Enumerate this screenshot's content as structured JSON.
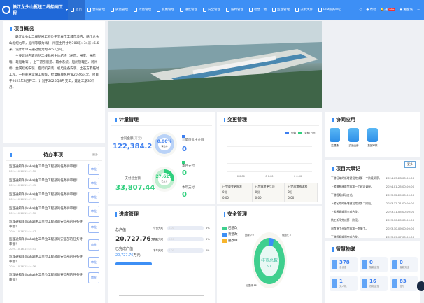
{
  "header": {
    "title": "赣江龙头山枢纽二线船闸工程",
    "nav": [
      "首页",
      "合同管理",
      "质量管理",
      "计量管理",
      "变更管理",
      "进度管理",
      "安全管理",
      "履约管理",
      "智慧工地",
      "监理管理",
      "决策大屏",
      "BIM服务中心"
    ],
    "help": "帮助",
    "notify": "通知",
    "notify_badge": "99+",
    "user": "湘金城"
  },
  "intro": {
    "title": "项目概况",
    "p1": "赣江龙头山二线船闸工程位于宜春市丰城市境内，赣江龙头山枢纽右岸，船闸等级为Ⅱ级，闸室主尺寸为300米×34米×5.6米，设计年单向通过能力为3763万吨。",
    "p2": "主要建设内容包括二线船闸主体结构（闸首、闸室、导航墙、靠船墩等），上下游引航道、输水系统、船闸管理区、跨闸桥、金属结构安装、启闭机安装、机电设备安装、土石方及临时工程、一线船闸实施工程等，批复概算总投资20.46亿元。项目于2023年8月开工，计划于2026年8月交工，建设工期36个月。"
  },
  "todo": {
    "title": "待办事项",
    "more": "更多",
    "action": "审批",
    "items": [
      {
        "text": "监理通知单(haha)由工单位工程部的任务待审批！",
        "time": "2024-10-16 15:17:50"
      },
      {
        "text": "监理通知单(haha)由工单位工程部的任务待审批！",
        "time": "2024-10-16 15:17:45"
      },
      {
        "text": "监理通知单(haha)由工单位工程部的任务待审批！",
        "time": "2024-10-16 15:17:39"
      },
      {
        "text": "监理通知单(haha)由工单位工程部的任务待审批！",
        "time": "2024-10-16 15:17:30"
      },
      {
        "text": "监理通知单(haha)由工单位工程部的安全部的任务待审批！",
        "time": "2024-10-16 15:14:47"
      },
      {
        "text": "监理通知单(haha)由工单位工程部的安全部的任务待审批！",
        "time": "2024-10-16 15:14:41"
      },
      {
        "text": "监理通知单(haha)由工单位工程部的安全部的任务待审批！",
        "time": "2024-10-16 15:14:36"
      },
      {
        "text": "监理通知单(haha)由工单位工程部的安全部的任务待审批！",
        "time": ""
      }
    ]
  },
  "measure": {
    "title": "计量管理",
    "contract_label": "合同金额",
    "unit": "(万元)",
    "contract": "122,384.27",
    "pct1": "0.00%",
    "pct1_label": "审批中",
    "paid_label": "支付总金额",
    "paid": "33,807.44",
    "pct2": "27.62%",
    "pct2_label": "已支付",
    "pct2_value": 27.62,
    "review_label": "计量审批中金额",
    "review": "0",
    "month_label": "本月支付",
    "month": "0",
    "year_label": "本年支付",
    "year": "0"
  },
  "change": {
    "title": "变更管理",
    "legend": [
      "份数",
      "金额(万元)"
    ],
    "xlabels": [
      "0  0.00",
      "0  0.00",
      "0  0.00"
    ],
    "stats": [
      {
        "label": "已完成变更批准",
        "count": "0份",
        "amount": "0.00"
      },
      {
        "label": "已完成变更立项",
        "count": "0份",
        "amount": "0.00"
      },
      {
        "label": "已完成审核流程",
        "count": "0份",
        "amount": "0.00"
      }
    ]
  },
  "collab": {
    "title": "协同应用",
    "apps": [
      "监理通",
      "交通运营",
      "集团审核"
    ]
  },
  "events": {
    "title": "项目大事记",
    "more": "更多",
    "items": [
      {
        "t": "下游区域的新增建设完成第一个阶段调停。",
        "d": "2024-03-28 00:00:00"
      },
      {
        "t": "上游最新建筑完成第一个建设调停。",
        "d": "2024-01-25 00:00:00"
      },
      {
        "t": "下游围堰成功合龙。",
        "d": "2023-12-29 00:00:00"
      },
      {
        "t": "下游区域的新增建设完成第二阶段。",
        "d": "2023-12-21 00:00:00"
      },
      {
        "t": "上游围堰顺利完成合龙。",
        "d": "2023-11-05 00:00:00"
      },
      {
        "t": "航工新闸完成第一阶段。",
        "d": "2023-10-20 00:00:00"
      },
      {
        "t": "闸首施工开始完成第一期施工。",
        "d": "2023-10-09 00:00:00"
      },
      {
        "t": "下游围堰顺利完成合龙。",
        "d": "2023-09-07 00:00:00"
      },
      {
        "t": "顶部新闸建设完成第一期调停。",
        "d": "2023-08-22 00:00:00"
      }
    ]
  },
  "progress": {
    "title": "进度管理",
    "total_label": "总产值",
    "total": "20,727.76",
    "unit": "万元",
    "done_label": "已完成产值",
    "done": "20,727.76",
    "done_unit": "万元",
    "bars": [
      {
        "label": "今日完成",
        "value": "0.00",
        "pct": "0%"
      },
      {
        "label": "本月完成",
        "value": "0.00",
        "pct": "0%"
      },
      {
        "label": "本年完成",
        "value": "0.00",
        "pct": "0%"
      }
    ]
  },
  "safety": {
    "title": "安全管理",
    "legend": [
      "已整改",
      "待整改",
      "整改中"
    ],
    "center": "排查总数",
    "total": "91",
    "labels": [
      "整改中 0",
      "待整改 3",
      "已整改 88"
    ],
    "colors": [
      "#3fcf8e",
      "#3d8ff5",
      "#f7b52c"
    ]
  },
  "iot": {
    "title": "智慧物联",
    "items": [
      {
        "v": "378",
        "l": "总设备"
      },
      {
        "v": "0",
        "l": "智能监控"
      },
      {
        "v": "0",
        "l": "智能安全"
      },
      {
        "v": "1",
        "l": "无人机"
      },
      {
        "v": "16",
        "l": "视频监控"
      },
      {
        "v": "83",
        "l": "塔吊"
      }
    ]
  }
}
